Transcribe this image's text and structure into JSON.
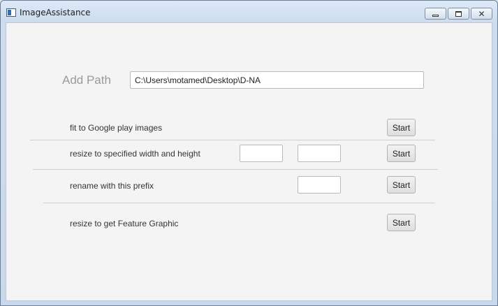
{
  "window": {
    "title": "ImageAssistance"
  },
  "path": {
    "label": "Add Path",
    "value": "C:\\Users\\motamed\\Desktop\\D-NA"
  },
  "rows": [
    {
      "label": "fit to Google play images",
      "button": "Start"
    },
    {
      "label": "resize to specified width and height",
      "button": "Start",
      "width_value": "",
      "height_value": ""
    },
    {
      "label": "rename with this prefix",
      "button": "Start",
      "prefix_value": ""
    },
    {
      "label": "resize to get Feature Graphic",
      "button": "Start"
    }
  ]
}
